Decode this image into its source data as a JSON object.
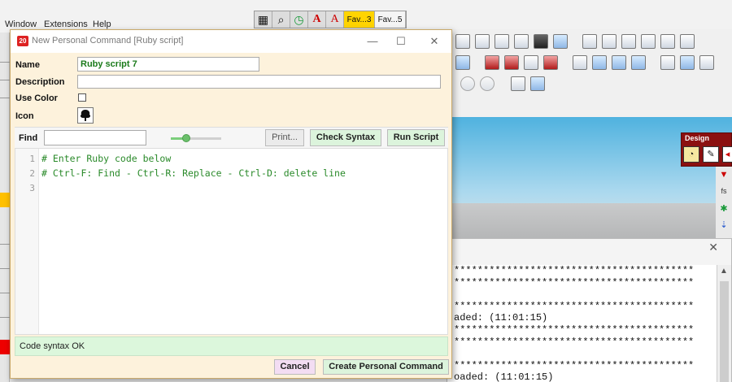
{
  "menubar": {
    "items": [
      "Window",
      "Extensions",
      "Help"
    ]
  },
  "favbar": {
    "fav1": "Fav...3",
    "fav2": "Fav...5"
  },
  "design_panel": {
    "label": "Design"
  },
  "dialog": {
    "badge": "20",
    "title": "New Personal Command [Ruby script]",
    "minimize": "—",
    "maximize": "☐",
    "close": "✕"
  },
  "form": {
    "name_label": "Name",
    "name_value": "Ruby script 7",
    "description_label": "Description",
    "description_value": "",
    "use_color_label": "Use Color",
    "use_color_checked": false,
    "icon_label": "Icon",
    "icon": "tree-icon"
  },
  "find_bar": {
    "label": "Find",
    "value": "",
    "slider_level": 0.3,
    "print_label": "Print...",
    "check_label": "Check Syntax",
    "run_label": "Run Script"
  },
  "editor": {
    "lines": [
      {
        "num": "1",
        "text": "# Enter Ruby code below"
      },
      {
        "num": "2",
        "text": "# Ctrl-F: Find - Ctrl-R: Replace - Ctrl-D: delete line"
      },
      {
        "num": "3",
        "text": ""
      }
    ]
  },
  "status": {
    "text": "Code syntax OK"
  },
  "buttons": {
    "cancel": "Cancel",
    "create": "Create Personal Command"
  },
  "console": {
    "close": "✕",
    "lines": [
      "*****************************************",
      "*****************************************",
      "",
      "*****************************************",
      "aded: (11:01:15)",
      "*****************************************",
      "*****************************************",
      "",
      "*****************************************",
      "oaded: (11:01:15)"
    ]
  },
  "colors": {
    "dialog_bg": "#fdf2dc",
    "accent_green": "#dcf4dc",
    "code_green": "#2a8a2a",
    "cancel_bg": "#f3ddf3"
  }
}
